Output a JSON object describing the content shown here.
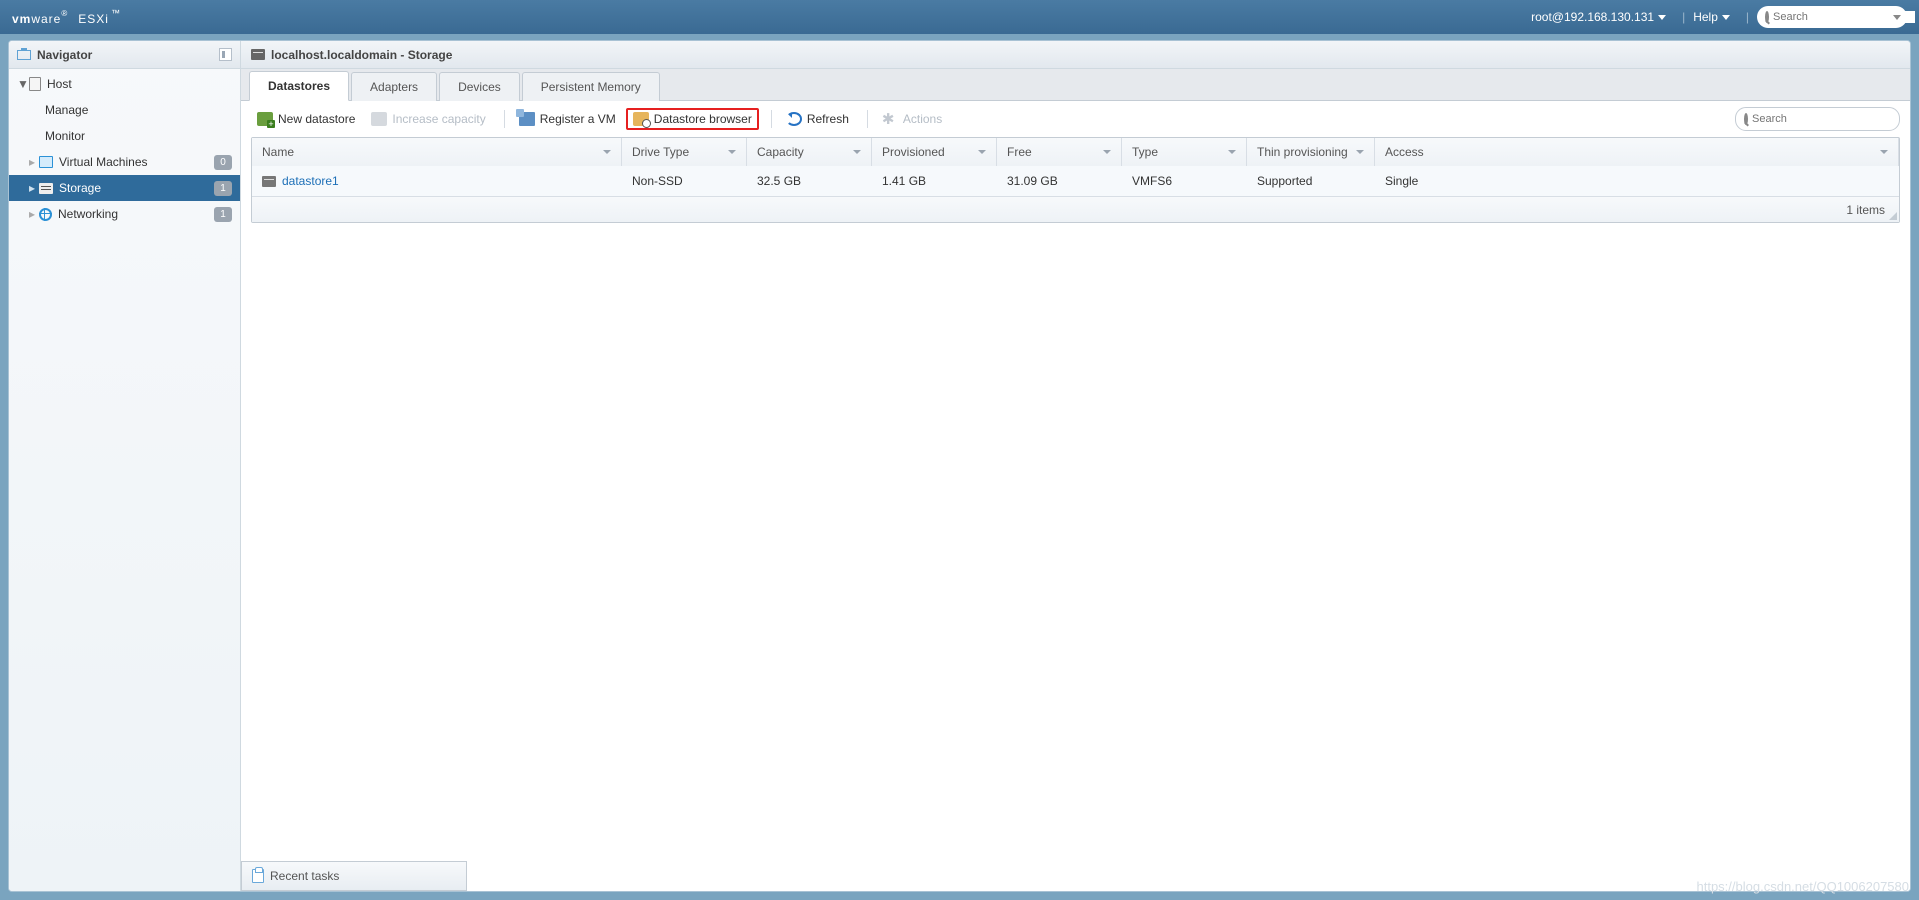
{
  "brand": {
    "vm": "vm",
    "ware": "ware",
    "product": "ESXi",
    "tm": "™"
  },
  "top": {
    "user": "root@192.168.130.131",
    "help": "Help",
    "search_placeholder": "Search"
  },
  "nav": {
    "title": "Navigator",
    "host": "Host",
    "manage": "Manage",
    "monitor": "Monitor",
    "vms": "Virtual Machines",
    "vms_count": "0",
    "storage": "Storage",
    "storage_count": "1",
    "networking": "Networking",
    "networking_count": "1"
  },
  "crumb": "localhost.localdomain - Storage",
  "tabs": {
    "datastores": "Datastores",
    "adapters": "Adapters",
    "devices": "Devices",
    "pmem": "Persistent Memory"
  },
  "toolbar": {
    "newds": "New datastore",
    "inc": "Increase capacity",
    "reg": "Register a VM",
    "browse": "Datastore browser",
    "refresh": "Refresh",
    "actions": "Actions",
    "search_placeholder": "Search"
  },
  "cols": {
    "name": "Name",
    "drive": "Drive Type",
    "cap": "Capacity",
    "prov": "Provisioned",
    "free": "Free",
    "type": "Type",
    "thin": "Thin provisioning",
    "acc": "Access"
  },
  "rows": [
    {
      "name": "datastore1",
      "drive": "Non-SSD",
      "cap": "32.5 GB",
      "prov": "1.41 GB",
      "free": "31.09 GB",
      "type": "VMFS6",
      "thin": "Supported",
      "acc": "Single"
    }
  ],
  "footer": "1 items",
  "recent": "Recent tasks",
  "watermark": "https://blog.csdn.net/QQ1006207580"
}
